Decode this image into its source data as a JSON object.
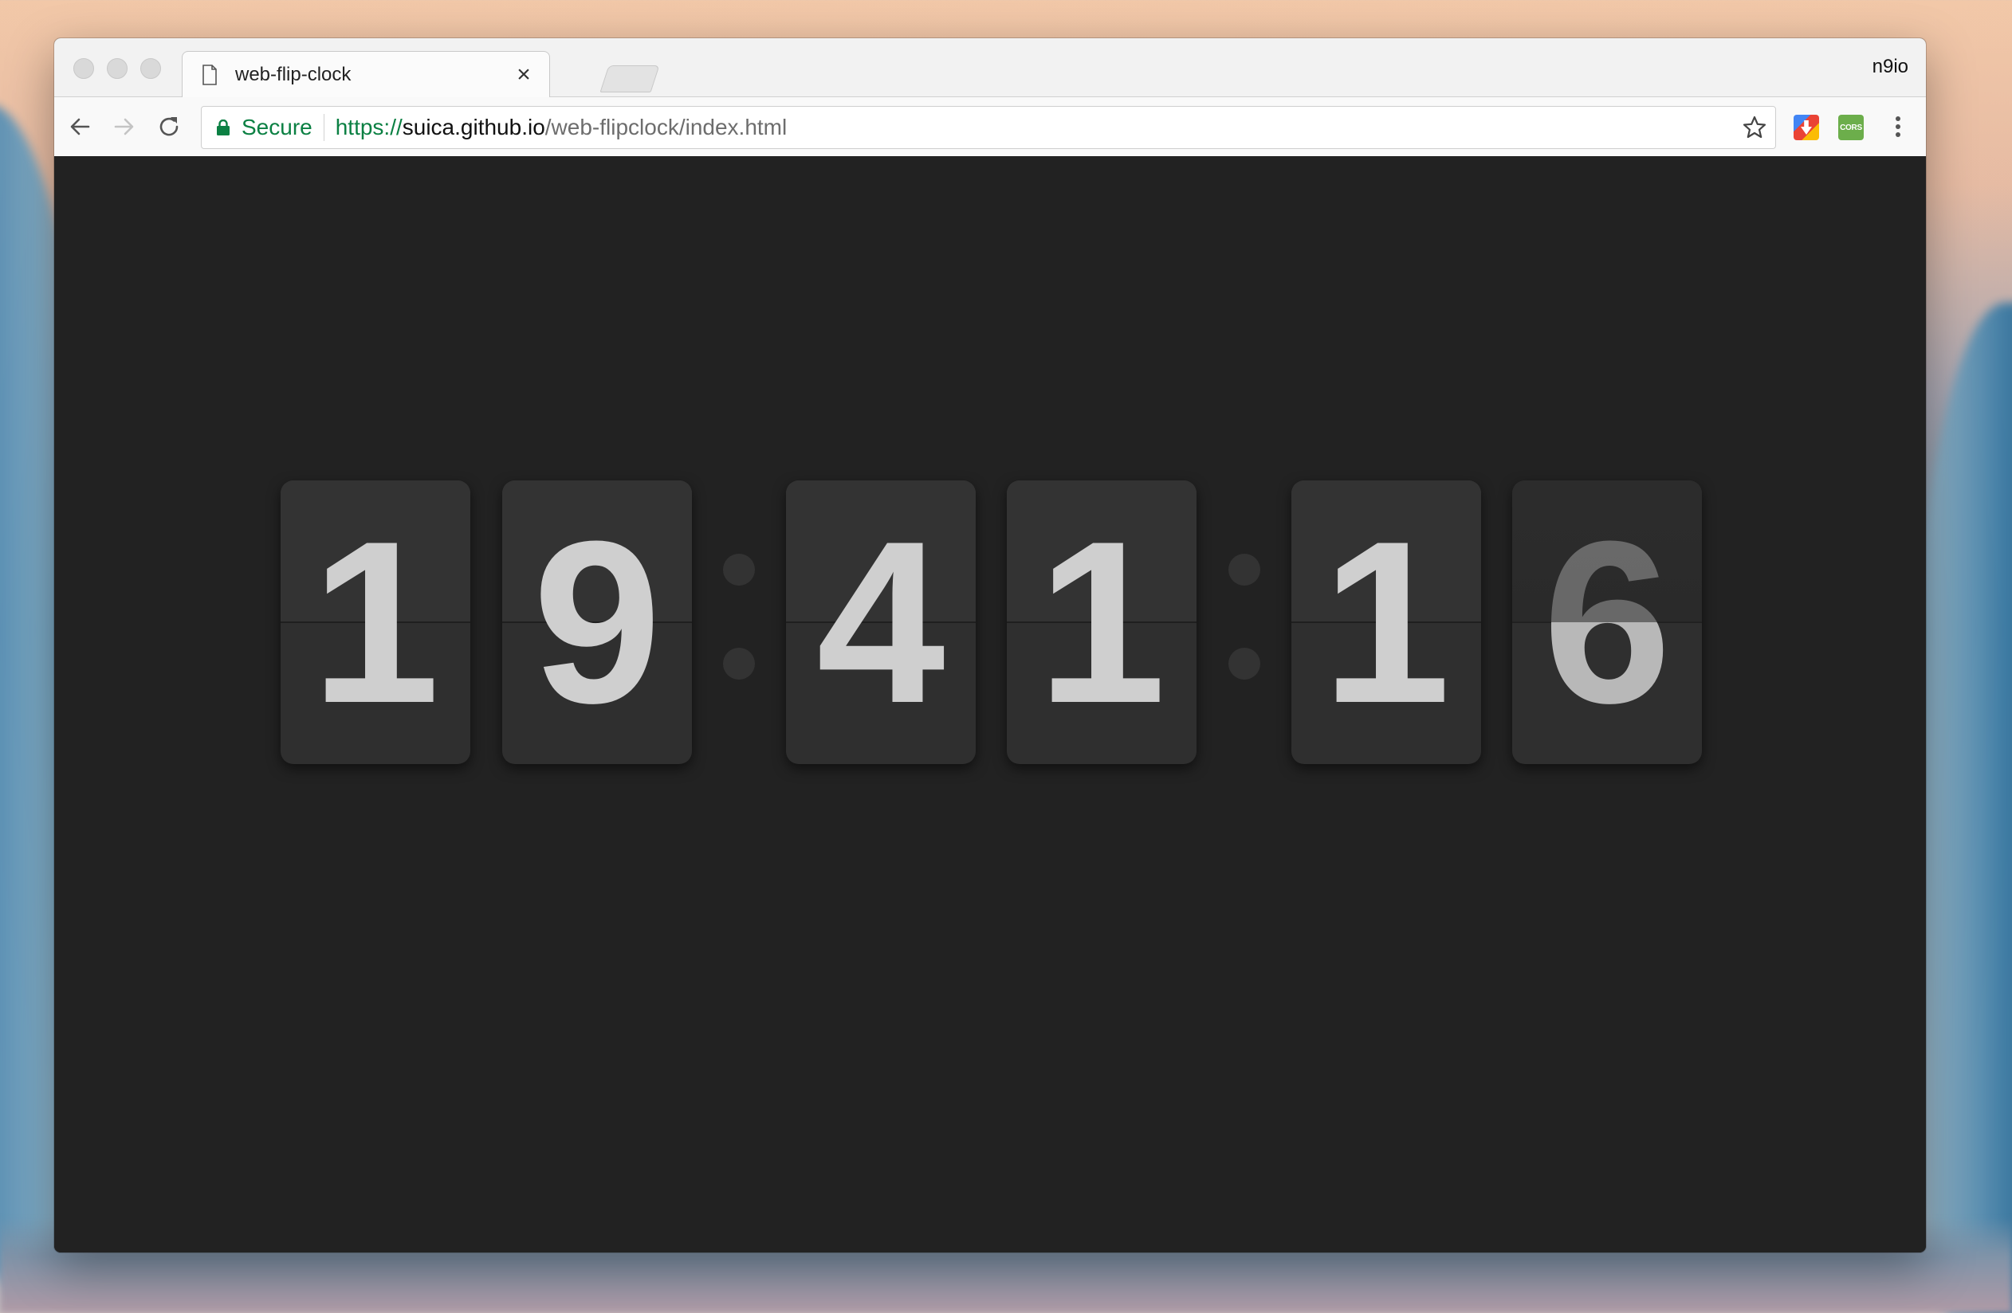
{
  "window": {
    "profile_name": "n9io"
  },
  "tab": {
    "title": "web-flip-clock",
    "close_glyph": "×",
    "icon": "document-icon"
  },
  "toolbar": {
    "secure_label": "Secure",
    "url_scheme": "https://",
    "url_host": "suica.github.io",
    "url_path": "/web-flipclock/index.html",
    "cors_label": "CORS",
    "icons": [
      "back-arrow-icon",
      "forward-arrow-icon",
      "reload-icon",
      "lock-icon",
      "star-icon",
      "download-extension-icon",
      "cors-extension-icon",
      "more-vert-icon"
    ]
  },
  "clock": {
    "hours": [
      "1",
      "9"
    ],
    "minutes": [
      "4",
      "1"
    ],
    "seconds": [
      "1",
      "6"
    ],
    "colors": {
      "background": "#222222",
      "card": "#2f2f2f",
      "digit": "#cfcfcf"
    }
  }
}
